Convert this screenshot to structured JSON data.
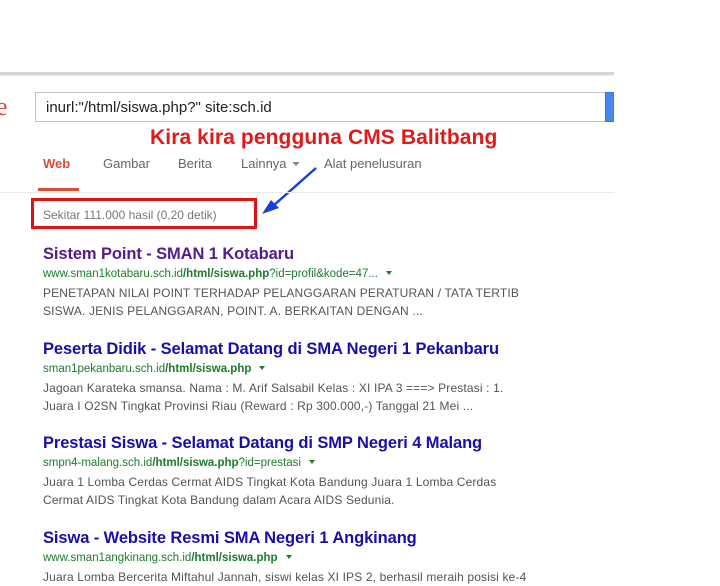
{
  "header": {
    "logo_fragment": "e",
    "query": "inurl:\"/html/siswa.php?\" site:sch.id"
  },
  "annotation": {
    "text": "Kira kira pengguna CMS Balitbang"
  },
  "tabs": [
    {
      "label": "Web",
      "active": true
    },
    {
      "label": "Gambar"
    },
    {
      "label": "Berita"
    },
    {
      "label": "Lainnya"
    },
    {
      "label": "Alat penelusuran"
    }
  ],
  "result_stats": "Sekitar 111.000 hasil (0,20 detik)",
  "results": [
    {
      "title": "Sistem Point - SMAN 1 Kotabaru",
      "url_pre": "www.sman1kotabaru.sch.id",
      "url_bold": "/html/siswa.php",
      "url_post": "?id=profil&kode=47...",
      "snippet_1": "PENETAPAN NILAI POINT TERHADAP PELANGGARAN PERATURAN / TATA TERTIB",
      "snippet_2": "SISWA. JENIS PELANGGARAN, POINT. A. BERKAITAN DENGAN ..."
    },
    {
      "title": "Peserta Didik - Selamat Datang di SMA Negeri 1 Pekanbaru",
      "url_pre": "sman1pekanbaru.sch.id",
      "url_bold": "/html/siswa.php",
      "url_post": "",
      "snippet_1": "Jagoan Karateka smansa. Nama : M. Arif Salsabil Kelas : XI IPA 3 ===> Prestasi : 1.",
      "snippet_2": "Juara I O2SN Tingkat Provinsi Riau (Reward : Rp 300.000,-) Tanggal 21 Mei ..."
    },
    {
      "title": "Prestasi Siswa - Selamat Datang di SMP Negeri 4 Malang",
      "url_pre": "smpn4-malang.sch.id",
      "url_bold": "/html/siswa.php",
      "url_post": "?id=prestasi",
      "snippet_1": "Juara 1 Lomba Cerdas Cermat AIDS Tingkat Kota Bandung Juara 1 Lomba Cerdas",
      "snippet_2": "Cermat AIDS Tingkat Kota Bandung dalam Acara AIDS Sedunia."
    },
    {
      "title": "Siswa - Website Resmi SMA Negeri 1 Angkinang",
      "url_pre": "www.sman1angkinang.sch.id",
      "url_bold": "/html/siswa.php",
      "url_post": "",
      "snippet_1": "Juara Lomba Bercerita Miftahul Jannah, siswi kelas XI IPS 2, berhasil meraih posisi ke-4",
      "snippet_2": ""
    }
  ],
  "colors": {
    "annotation_red": "#e01a1a",
    "link_blue": "#1a0dab",
    "url_green": "#1e7b2c",
    "tab_active": "#dd4b39"
  }
}
